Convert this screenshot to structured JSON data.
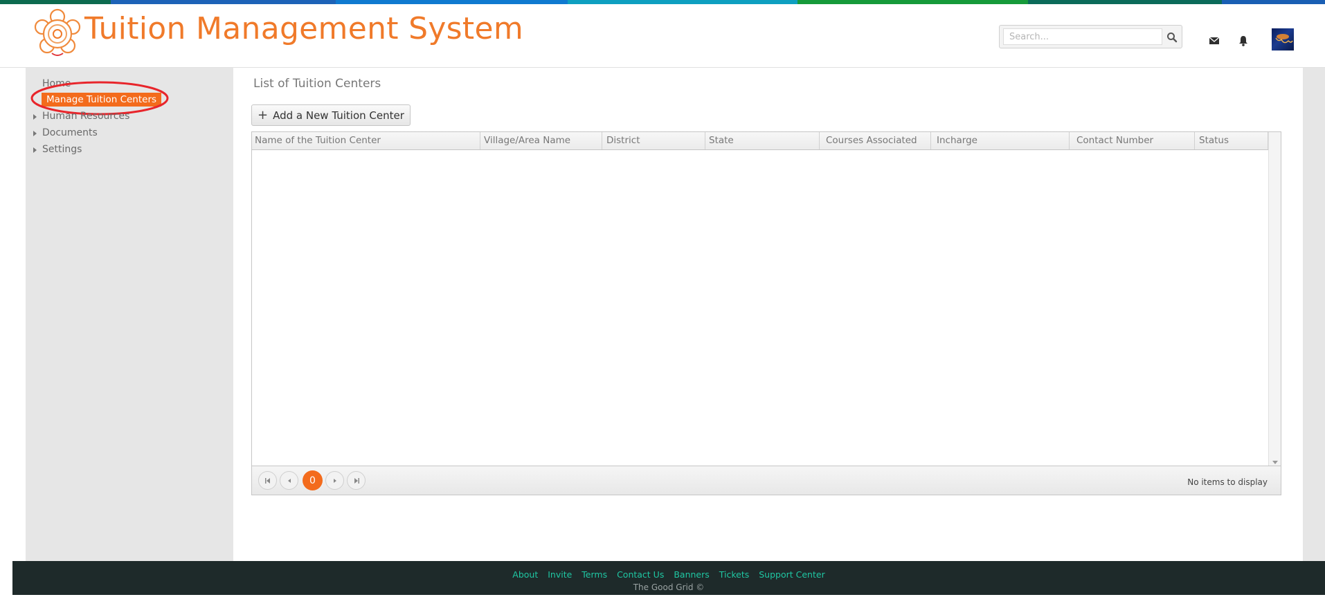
{
  "header": {
    "title": "Tuition Management System",
    "brand_color": "#f07a2a",
    "search": {
      "placeholder": "Search...",
      "value": ""
    },
    "icons": [
      "search-icon",
      "mail-icon",
      "bell-icon",
      "avatar"
    ]
  },
  "topbar_colors": [
    "#0d6b4f",
    "#1d63b8",
    "#0f7ad0",
    "#0e9fc0",
    "#169a3a",
    "#0b6b5a",
    "#1a5fb4"
  ],
  "sidebar": {
    "items": [
      {
        "label": "Home",
        "expandable": false
      },
      {
        "label": "Manage Tuition  Centers",
        "expandable": false,
        "active": true
      },
      {
        "label": "Human Resources",
        "expandable": true
      },
      {
        "label": "Documents",
        "expandable": true
      },
      {
        "label": "Settings",
        "expandable": true
      }
    ]
  },
  "main": {
    "page_title": "List of Tuition Centers",
    "add_button_label": "Add a New Tuition Center",
    "grid": {
      "columns": [
        "Name of the Tuition Center",
        "Village/Area Name",
        "District",
        "State",
        "Courses Associated",
        "Incharge",
        "Contact Number",
        "Status"
      ],
      "rows": [],
      "current_page": "0",
      "empty_message": "No items to display"
    }
  },
  "footer": {
    "links": [
      "About",
      "Invite",
      "Terms",
      "Contact Us",
      "Banners",
      "Tickets",
      "Support Center"
    ],
    "copyright": "The Good Grid ©",
    "link_color": "#1fc7a3"
  }
}
